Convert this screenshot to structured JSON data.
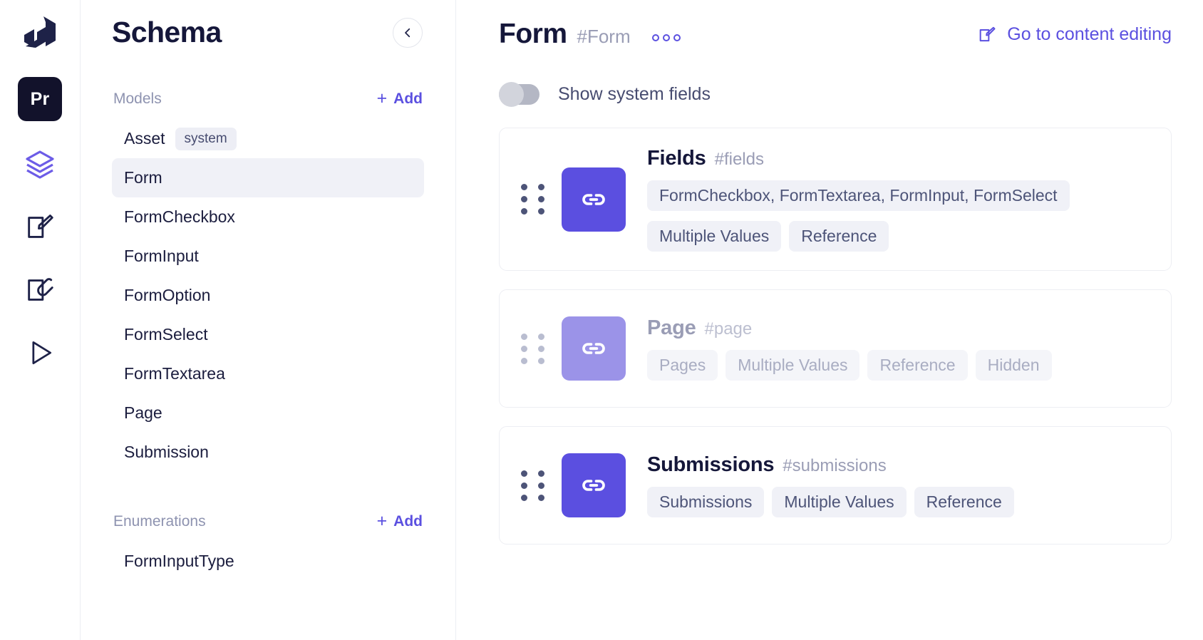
{
  "rail": {
    "logo_icon": "graphcms-logo-icon",
    "project_badge": "Pr",
    "icons": [
      {
        "name": "layers-icon",
        "active": true
      },
      {
        "name": "content-edit-icon",
        "active": false
      },
      {
        "name": "assets-edit-icon",
        "active": false
      },
      {
        "name": "api-playground-icon",
        "active": false
      }
    ]
  },
  "sidebar": {
    "title": "Schema",
    "collapse_icon": "chevron-left-icon",
    "groups": [
      {
        "label": "Models",
        "add_label": "Add",
        "add_icon": "plus-icon",
        "items": [
          {
            "label": "Asset",
            "badge": "system",
            "active": false
          },
          {
            "label": "Form",
            "badge": "",
            "active": true
          },
          {
            "label": "FormCheckbox",
            "badge": "",
            "active": false
          },
          {
            "label": "FormInput",
            "badge": "",
            "active": false
          },
          {
            "label": "FormOption",
            "badge": "",
            "active": false
          },
          {
            "label": "FormSelect",
            "badge": "",
            "active": false
          },
          {
            "label": "FormTextarea",
            "badge": "",
            "active": false
          },
          {
            "label": "Page",
            "badge": "",
            "active": false
          },
          {
            "label": "Submission",
            "badge": "",
            "active": false
          }
        ]
      },
      {
        "label": "Enumerations",
        "add_label": "Add",
        "add_icon": "plus-icon",
        "items": [
          {
            "label": "FormInputType",
            "badge": "",
            "active": false
          }
        ]
      }
    ]
  },
  "main": {
    "title": "Form",
    "api_id": "#Form",
    "more_icon": "more-options-icon",
    "content_link": {
      "label": "Go to content editing",
      "icon": "pencil-square-icon"
    },
    "system_fields_toggle": {
      "label": "Show system fields",
      "on": false
    },
    "fields": [
      {
        "name": "Fields",
        "api_id": "#fields",
        "icon": "link-icon",
        "muted": false,
        "value_pill": "FormCheckbox, FormTextarea, FormInput, FormSelect",
        "pills": [
          "Multiple Values",
          "Reference"
        ]
      },
      {
        "name": "Page",
        "api_id": "#page",
        "icon": "link-icon",
        "muted": true,
        "value_pill": "",
        "pills": [
          "Pages",
          "Multiple Values",
          "Reference",
          "Hidden"
        ]
      },
      {
        "name": "Submissions",
        "api_id": "#submissions",
        "icon": "link-icon",
        "muted": false,
        "value_pill": "",
        "pills": [
          "Submissions",
          "Multiple Values",
          "Reference"
        ]
      }
    ]
  },
  "colors": {
    "accent": "#5b50e0",
    "tile": "#5b4fe0",
    "tile_muted": "#9b93e8",
    "ink": "#15173a",
    "muted_text": "#9a9db5"
  }
}
